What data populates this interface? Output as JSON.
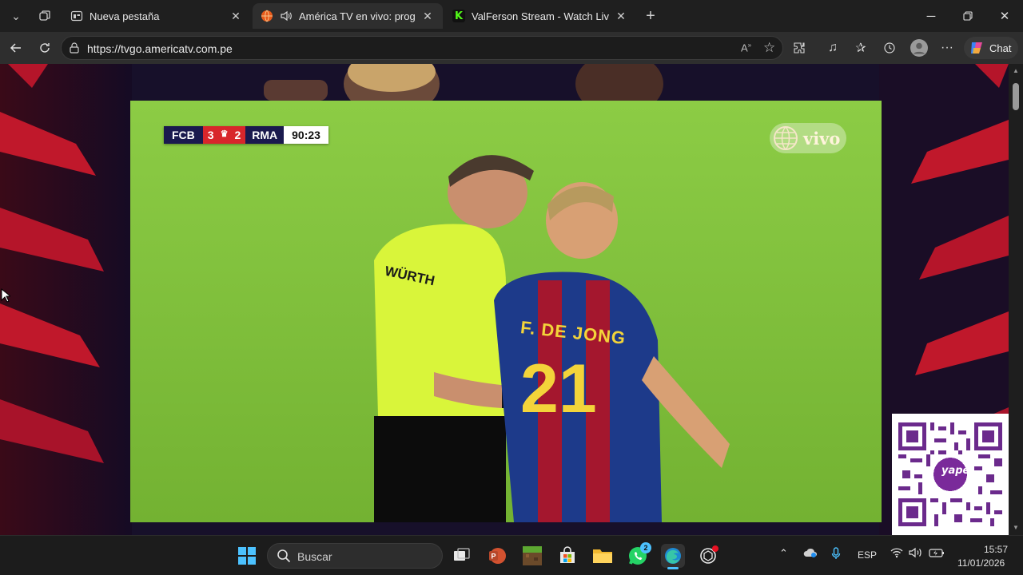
{
  "tabs": [
    {
      "title": "Nueva pestaña",
      "favicon": "new-tab-page-icon",
      "active": false
    },
    {
      "title": "América TV en vivo: programación",
      "favicon": "america-tv-globe-icon",
      "muted_icon": "speaker-icon",
      "active": true
    },
    {
      "title": "ValFerson Stream - Watch Live on Kick",
      "favicon": "kick-k-icon",
      "active": false
    }
  ],
  "address_bar": {
    "url": "https://tvgo.americatv.com.pe"
  },
  "toolbar": {
    "chat_label": "Chat"
  },
  "video": {
    "scoreboard": {
      "home": "FCB",
      "home_score": "3",
      "away_score": "2",
      "away": "RMA",
      "time": "90:23"
    },
    "live_logo": "vivo",
    "jersey_name": "F. DE JONG",
    "jersey_number": "21",
    "referee_sponsor": "WÜRTH"
  },
  "qr": {
    "brand": "yape"
  },
  "taskbar": {
    "search_placeholder": "Buscar",
    "whatsapp_badge": "2",
    "language": "ESP",
    "time": "15:57",
    "date": "11/01/2026"
  },
  "colors": {
    "browser_bg": "#1f1f1f",
    "active_tab": "#2e2e2e",
    "pitch": "#7fbf3a",
    "scoreboard_red": "#d8262b",
    "scoreboard_navy": "#1a1a4e",
    "page_bg": "#17102a",
    "side_red": "#c0182b"
  }
}
